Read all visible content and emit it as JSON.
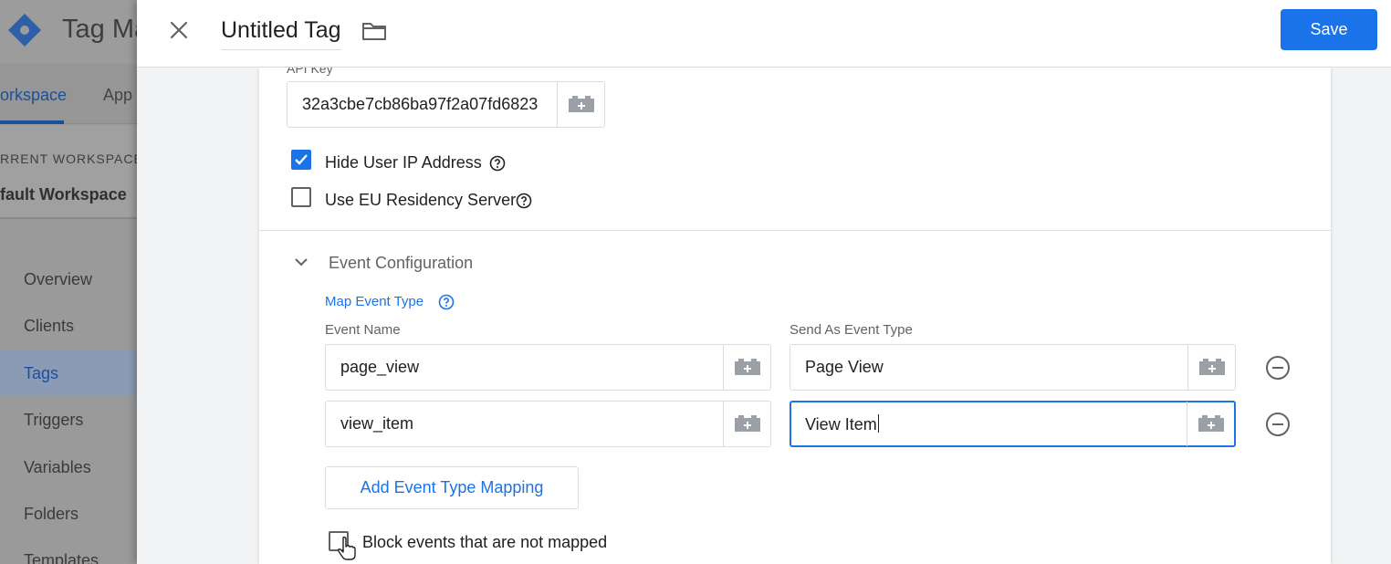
{
  "background_app": {
    "app_title": "Tag Ma",
    "tabs": [
      "orkspace",
      "App"
    ],
    "workspace_label": "RRENT WORKSPACE",
    "workspace_name": "fault Workspace",
    "nav_items": [
      "Overview",
      "Clients",
      "Tags",
      "Triggers",
      "Variables",
      "Folders",
      "Templates"
    ],
    "active_nav": "Tags",
    "colors": {
      "logo": "#2f5fa8",
      "active": "#1c4f9a"
    }
  },
  "header": {
    "tag_title": "Untitled Tag",
    "save_label": "Save",
    "close_icon": "close-icon",
    "folder_icon": "folder-icon"
  },
  "config": {
    "api_key_label": "API Key",
    "api_key_value": "32a3cbe7cb86ba97f2a07fd6823",
    "hide_ip_label": "Hide User IP Address",
    "hide_ip_checked": true,
    "eu_server_label": "Use EU Residency Server",
    "eu_server_checked": false
  },
  "event_config": {
    "section_title": "Event Configuration",
    "map_label": "Map Event Type",
    "col_event_name": "Event Name",
    "col_send_as": "Send As Event Type",
    "rows": [
      {
        "event_name": "page_view",
        "event_type": "Page View"
      },
      {
        "event_name": "view_item",
        "event_type": "View Item"
      }
    ],
    "add_mapping_label": "Add Event Type Mapping",
    "block_label": "Block events that are not mapped",
    "block_checked": false
  },
  "colors": {
    "primary": "#1a73e8",
    "text": "#202124",
    "secondary_text": "#5f6368",
    "border": "#dadce0"
  }
}
